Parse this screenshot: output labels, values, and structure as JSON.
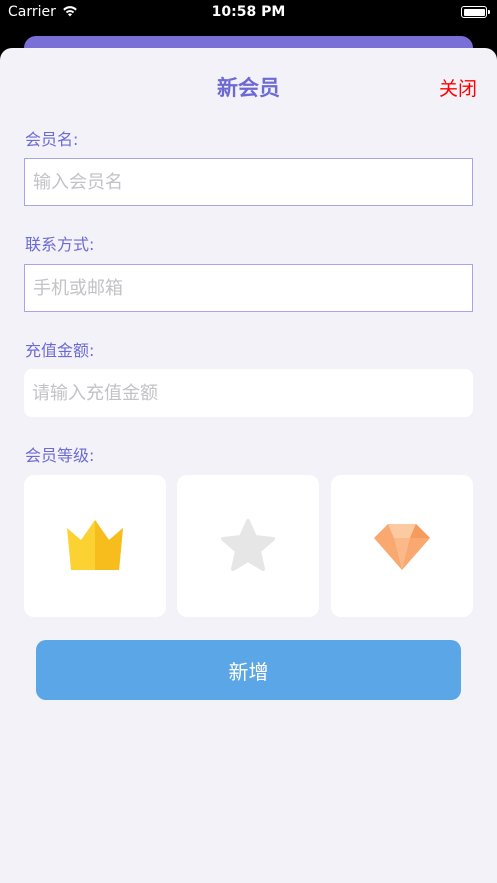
{
  "status_bar": {
    "carrier": "Carrier",
    "time": "10:58 PM",
    "icons": [
      "wifi-icon",
      "battery-icon"
    ]
  },
  "header": {
    "title": "新会员",
    "close_label": "关闭"
  },
  "form": {
    "name": {
      "label": "会员名:",
      "placeholder": "输入会员名"
    },
    "contact": {
      "label": "联系方式:",
      "placeholder": "手机或邮箱"
    },
    "recharge": {
      "label": "充值金额:",
      "placeholder": "请输入充值金额"
    },
    "level": {
      "label": "会员等级:",
      "options": [
        {
          "icon": "crown-icon"
        },
        {
          "icon": "star-icon"
        },
        {
          "icon": "diamond-icon"
        }
      ]
    },
    "submit_label": "新增"
  },
  "colors": {
    "accent": "#6e6ad4",
    "close": "#ff0000",
    "button": "#5ba6e6",
    "background": "#f2f2f8"
  }
}
